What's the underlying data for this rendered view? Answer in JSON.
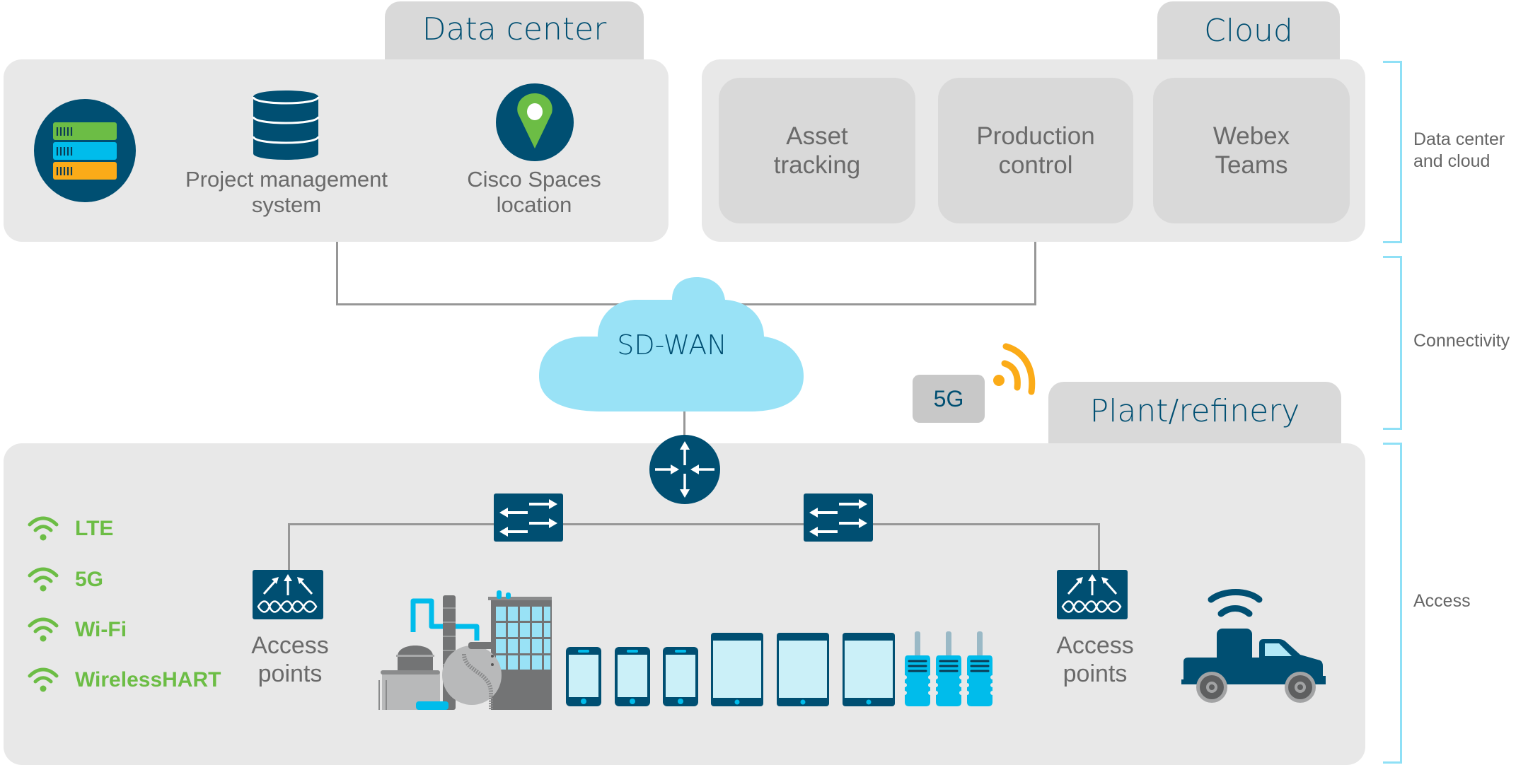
{
  "colors": {
    "brand_dark": "#004f72",
    "accent_cyan": "#00bceb",
    "cloud_light": "#99e2f6",
    "wireless_green": "#6cbd45",
    "signal_orange": "#fbab18",
    "bracket_cyan": "#8fe0f6",
    "panel_gray": "#e8e8e8",
    "card_gray": "#d9d9d9",
    "text_gray": "#6a6a6a"
  },
  "data_center": {
    "title": "Data center",
    "items": [
      {
        "icon": "server-stack-icon",
        "label": ""
      },
      {
        "icon": "database-icon",
        "label_line1": "Project management",
        "label_line2": "system"
      },
      {
        "icon": "location-pin-icon",
        "label_line1": "Cisco Spaces",
        "label_line2": "location"
      }
    ]
  },
  "cloud": {
    "title": "Cloud",
    "cards": [
      {
        "line1": "Asset",
        "line2": "tracking"
      },
      {
        "line1": "Production",
        "line2": "control"
      },
      {
        "line1": "Webex",
        "line2": "Teams"
      }
    ]
  },
  "connectivity": {
    "sdwan_label": "SD-WAN",
    "cellular_label": "5G",
    "cellular_icon": "signal-waves-icon"
  },
  "plant": {
    "title": "Plant/refinery",
    "wireless_legend": [
      "LTE",
      "5G",
      "Wi-Fi",
      "WirelessHART"
    ],
    "access_point_left": {
      "line1": "Access",
      "line2": "points"
    },
    "access_point_right": {
      "line1": "Access",
      "line2": "points"
    },
    "devices": {
      "phones": 3,
      "tablets": 3,
      "radios": 3
    },
    "icons": [
      "router-icon",
      "switch-icon",
      "switch-icon",
      "access-point-icon",
      "access-point-icon",
      "refinery-icon",
      "truck-tracker-icon"
    ]
  },
  "layers": [
    {
      "line1": "Data center",
      "line2": "and cloud"
    },
    {
      "line1": "Connectivity",
      "line2": ""
    },
    {
      "line1": "Access",
      "line2": ""
    }
  ]
}
